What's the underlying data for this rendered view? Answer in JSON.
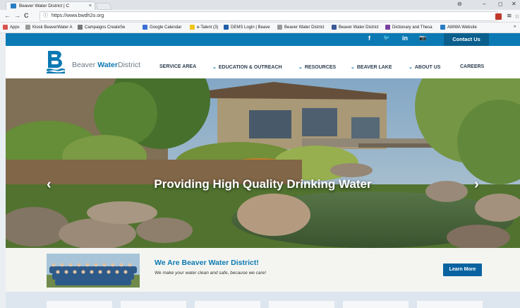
{
  "browser": {
    "tab_title": "Beaver Water District | C",
    "tab_close": "×",
    "url": "https://www.bwdh2o.org",
    "window_controls": [
      "⊖",
      "–",
      "◻",
      "✕"
    ],
    "nav_icons": [
      "←",
      "→",
      "C"
    ],
    "bookmarks": [
      {
        "label": "Apps",
        "color": "#d9534f"
      },
      {
        "label": "Kiosk BeaverWater A",
        "color": "#999999"
      },
      {
        "label": "Campaigns CreateSe",
        "color": "#777777"
      },
      {
        "label": "Google Calendar",
        "color": "#3b6fd6"
      },
      {
        "label": "e-Talent (3)",
        "color": "#f0c419"
      },
      {
        "label": "DEMS Login | Beave",
        "color": "#1f5fa8"
      },
      {
        "label": "Beaver Water District",
        "color": "#999999"
      },
      {
        "label": "Beaver Water District",
        "color": "#3b5998"
      },
      {
        "label": "Dictionary and Thesa",
        "color": "#7b3fa0"
      },
      {
        "label": "AWWA Website",
        "color": "#2a7cc2"
      }
    ],
    "more_bookmarks": "»"
  },
  "site": {
    "social": [
      "f",
      "🐦",
      "in",
      "📷"
    ],
    "contact_label": "Contact Us",
    "logo_prefix": "Beaver ",
    "logo_bold": "Water",
    "logo_suffix": "District",
    "nav": [
      {
        "label": "SERVICE AREA",
        "dropdown": false
      },
      {
        "label": "EDUCATION & OUTREACH",
        "dropdown": true
      },
      {
        "label": "RESOURCES",
        "dropdown": true
      },
      {
        "label": "BEAVER LAKE",
        "dropdown": true
      },
      {
        "label": "ABOUT US",
        "dropdown": true
      },
      {
        "label": "CAREERS",
        "dropdown": false
      }
    ],
    "hero_title": "Providing High Quality Drinking Water",
    "hero_prev": "‹",
    "hero_next": "›",
    "intro_title": "We Are Beaver Water District!",
    "intro_subtitle": "We make your water clean and safe, because we care!",
    "learn_more": "Learn More",
    "colors": {
      "primary": "#0b79b3",
      "dark_primary": "#0a5f8d"
    }
  }
}
